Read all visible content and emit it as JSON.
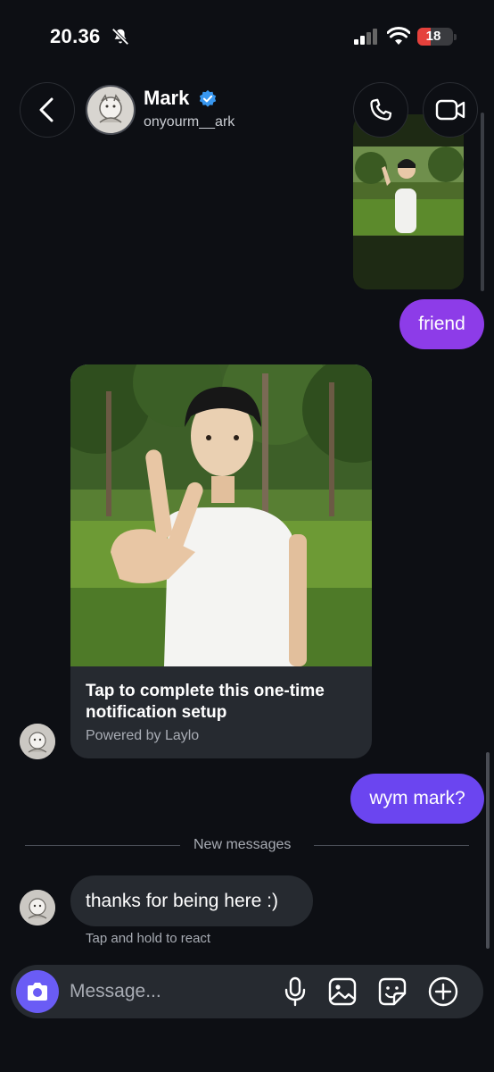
{
  "status_bar": {
    "time": "20.36",
    "battery": "18"
  },
  "header": {
    "name": "Mark",
    "handle": "onyourm__ark"
  },
  "messages": {
    "friend": "friend",
    "card_title": "Tap to complete this one-time notification setup",
    "card_subtitle": "Powered by Laylo",
    "wym": "wym mark?",
    "new_messages_divider": "New messages",
    "thanks": "thanks for being here :)",
    "react_hint": "Tap and hold to react"
  },
  "composer": {
    "placeholder": "Message..."
  },
  "colors": {
    "outgoing_purple": "#8d3ce8",
    "outgoing_violet": "#6b45f0",
    "verified_blue": "#3897f0",
    "camera_button": "#6a5cf5"
  },
  "icons": [
    "mute-icon",
    "signal-icon",
    "wifi-icon",
    "battery-icon",
    "back-icon",
    "verified-icon",
    "phone-icon",
    "video-icon",
    "camera-icon",
    "mic-icon",
    "gallery-icon",
    "sticker-icon",
    "plus-icon"
  ]
}
